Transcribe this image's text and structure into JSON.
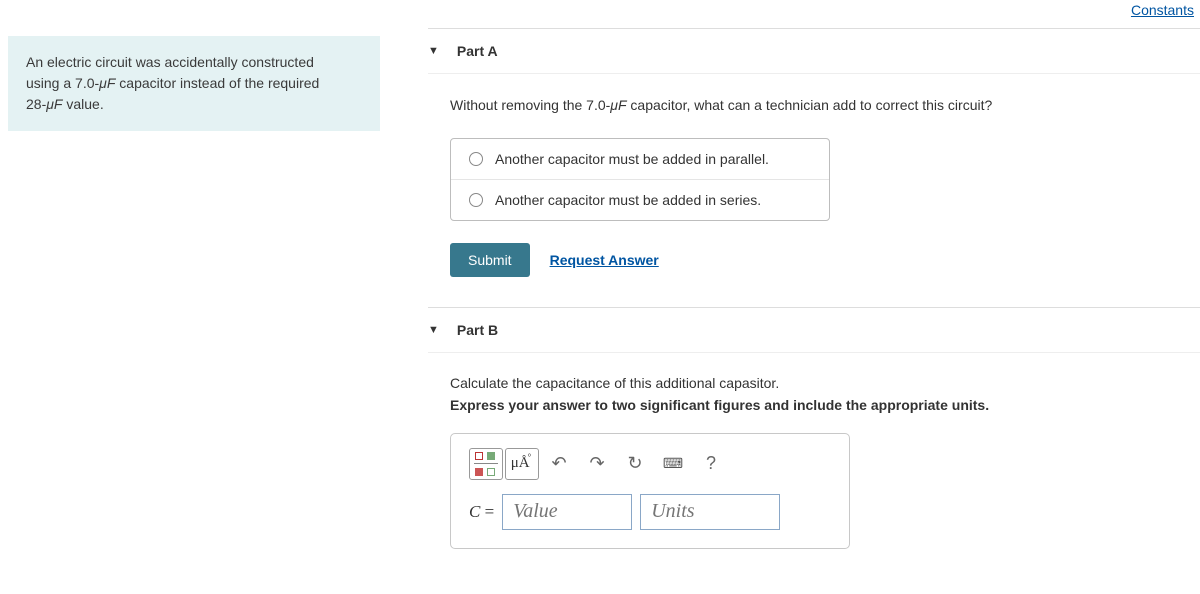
{
  "topLinks": {
    "constants": "Constants"
  },
  "problem": {
    "line1": "An electric circuit was accidentally constructed",
    "line2_a": "using a 7.0-",
    "line2_b": " capacitor instead of the required",
    "line3_a": "28-",
    "line3_b": " value.",
    "mu": "μF"
  },
  "partA": {
    "title": "Part A",
    "prompt_a": "Without removing the 7.0-",
    "prompt_b": " capacitor, what can a technician add to correct this circuit?",
    "mu": "μF",
    "option1": "Another capacitor must be added in parallel.",
    "option2": "Another capacitor must be added in series.",
    "submit": "Submit",
    "request": "Request Answer"
  },
  "partB": {
    "title": "Part B",
    "prompt": "Calculate the capacitance of this additional capasitor.",
    "instruction": "Express your answer to two significant figures and include the appropriate units.",
    "label_var": "C",
    "label_eq": " = ",
    "value_placeholder": "Value",
    "units_placeholder": "Units",
    "toolbar": {
      "units_btn": "μÅ",
      "help": "?",
      "ring": "°"
    }
  }
}
